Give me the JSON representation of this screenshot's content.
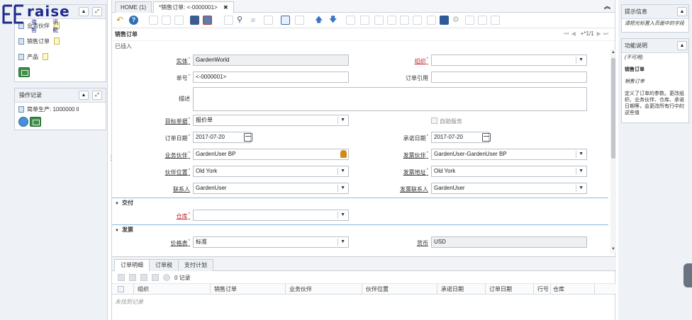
{
  "logo": {
    "word": "raise",
    "tagline": "资 讯 智 能"
  },
  "left": {
    "favorites": {
      "title": "收藏",
      "items": [
        {
          "label": "业务伙伴"
        },
        {
          "label": "销售订单"
        },
        {
          "label": "产品"
        }
      ]
    },
    "activity": {
      "title": "操作记录",
      "items": [
        {
          "label": "简单生产: 1000000 ll"
        }
      ]
    }
  },
  "tabs": [
    {
      "label": "HOME (1)"
    },
    {
      "label": "*销售订单: <-0000001>"
    }
  ],
  "window": {
    "title": "销售订单",
    "record_count": "+*1/1",
    "status": "已插入"
  },
  "form": {
    "client": {
      "label": "实体",
      "value": "GardenWorld"
    },
    "org": {
      "label": "组织",
      "value": ""
    },
    "doc_no": {
      "label": "单号",
      "value": "<-0000001>"
    },
    "order_ref": {
      "label": "订单引用",
      "value": ""
    },
    "description": {
      "label": "描述",
      "value": ""
    },
    "target_doc_type": {
      "label": "目标单据",
      "value": "报价单"
    },
    "self_service": {
      "label": "自助服务"
    },
    "date_ordered": {
      "label": "订单日期",
      "value": "2017-07-20"
    },
    "date_promised": {
      "label": "承诺日期",
      "value": "2017-07-20"
    },
    "bpartner": {
      "label": "业务伙伴",
      "value": "GardenUser BP"
    },
    "bill_partner": {
      "label": "发票伙伴",
      "value": "GardenUser-GardenUser BP"
    },
    "partner_location": {
      "label": "伙伴位置",
      "value": "Old York"
    },
    "bill_location": {
      "label": "发票地址",
      "value": "Old York"
    },
    "contact": {
      "label": "联系人",
      "value": "GardenUser"
    },
    "bill_contact": {
      "label": "发票联系人",
      "value": "GardenUser"
    },
    "section_delivery": "交付",
    "warehouse": {
      "label": "仓库",
      "value": ""
    },
    "section_invoice": "发票",
    "price_list": {
      "label": "价格表",
      "value": "标准"
    },
    "currency": {
      "label": "货币",
      "value": "USD"
    }
  },
  "detail": {
    "tabs": [
      {
        "label": "订单明细"
      },
      {
        "label": "订单税"
      },
      {
        "label": "支付计划"
      }
    ],
    "record_count": "0 记录",
    "columns": [
      "组织",
      "销售订单",
      "业务伙伴",
      "伙伴位置",
      "承诺日期",
      "订单日期",
      "行号",
      "仓库"
    ],
    "empty": "未找到记录"
  },
  "right": {
    "hint": {
      "title": "提示信息",
      "text": "请把光标置入页面中的字段"
    },
    "help": {
      "title": "功能说明",
      "na": "(不可用)",
      "name": "销售订单",
      "name_it": "销售订单",
      "desc": "定义了订单的参数。更改组织、业务伙伴、仓库、承诺日期等，会更改所有行中的这些值"
    }
  }
}
